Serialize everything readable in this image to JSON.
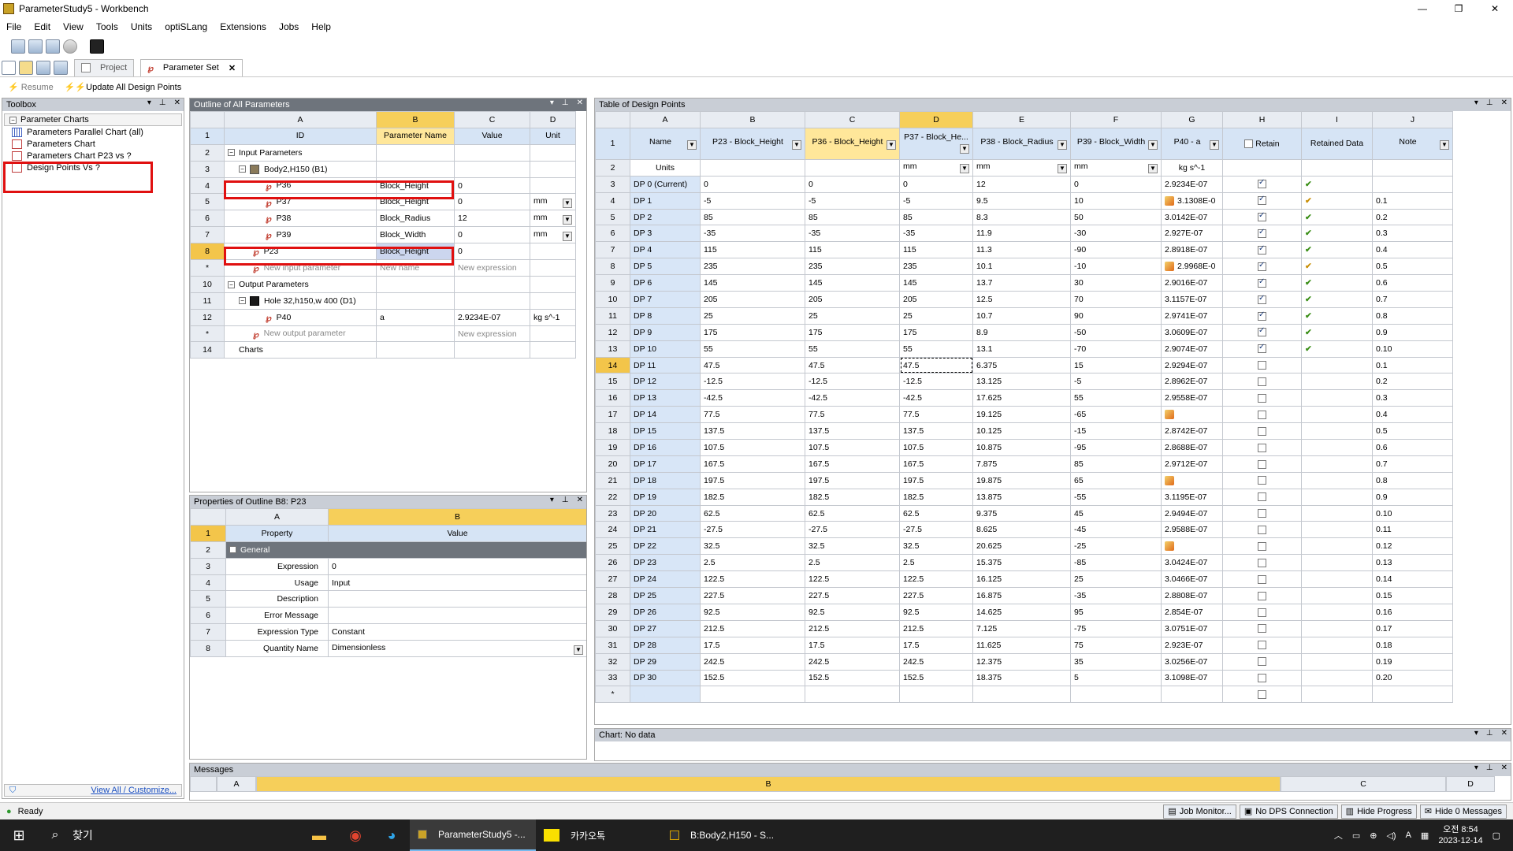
{
  "window": {
    "title": "ParameterStudy5 - Workbench"
  },
  "menu": [
    "File",
    "Edit",
    "View",
    "Tools",
    "Units",
    "optiSLang",
    "Extensions",
    "Jobs",
    "Help"
  ],
  "tabs": [
    {
      "label": "Project"
    },
    {
      "label": "Parameter Set"
    }
  ],
  "toolbar": {
    "resume": "Resume",
    "update_all": "Update All Design Points"
  },
  "toolbox": {
    "title": "Toolbox",
    "group": "Parameter Charts",
    "items": [
      "Parameters Parallel Chart (all)",
      "Parameters Chart",
      "Parameters Chart P23 vs ?",
      "Design Points Vs  ?"
    ],
    "footer": "View All / Customize..."
  },
  "outline": {
    "title": "Outline of All Parameters",
    "cols": [
      "A",
      "B",
      "C",
      "D"
    ],
    "headers": [
      "ID",
      "Parameter Name",
      "Value",
      "Unit"
    ],
    "rows": [
      {
        "n": "2",
        "id": "Input Parameters",
        "name": "",
        "value": "",
        "unit": ""
      },
      {
        "n": "3",
        "id": "Body2,H150 (B1)",
        "name": "",
        "value": "",
        "unit": ""
      },
      {
        "n": "4",
        "id": "P36",
        "name": "Block_Height",
        "value": "0",
        "unit": ""
      },
      {
        "n": "5",
        "id": "P37",
        "name": "Block_Height",
        "value": "0",
        "unit": "mm"
      },
      {
        "n": "6",
        "id": "P38",
        "name": "Block_Radius",
        "value": "12",
        "unit": "mm"
      },
      {
        "n": "7",
        "id": "P39",
        "name": "Block_Width",
        "value": "0",
        "unit": "mm"
      },
      {
        "n": "8",
        "id": "P23",
        "name": "Block_Height",
        "value": "0",
        "unit": ""
      },
      {
        "n": "*",
        "id": "New input parameter",
        "name": "New name",
        "value": "New expression",
        "unit": ""
      },
      {
        "n": "10",
        "id": "Output Parameters",
        "name": "",
        "value": "",
        "unit": ""
      },
      {
        "n": "11",
        "id": "Hole 32,h150,w 400 (D1)",
        "name": "",
        "value": "",
        "unit": ""
      },
      {
        "n": "12",
        "id": "P40",
        "name": "a",
        "value": "2.9234E-07",
        "unit": "kg s^-1"
      },
      {
        "n": "*",
        "id": "New output parameter",
        "name": "",
        "value": "New expression",
        "unit": ""
      },
      {
        "n": "14",
        "id": "Charts",
        "name": "",
        "value": "",
        "unit": ""
      }
    ]
  },
  "properties": {
    "title": "Properties of Outline B8: P23",
    "cols": [
      "A",
      "B"
    ],
    "headers": [
      "Property",
      "Value"
    ],
    "group": "General",
    "rows": [
      {
        "n": "3",
        "k": "Expression",
        "v": "0"
      },
      {
        "n": "4",
        "k": "Usage",
        "v": "Input"
      },
      {
        "n": "5",
        "k": "Description",
        "v": ""
      },
      {
        "n": "6",
        "k": "Error Message",
        "v": ""
      },
      {
        "n": "7",
        "k": "Expression Type",
        "v": "Constant"
      },
      {
        "n": "8",
        "k": "Quantity Name",
        "v": "Dimensionless"
      }
    ]
  },
  "design_points": {
    "title": "Table of Design Points",
    "cols": [
      "A",
      "B",
      "C",
      "D",
      "E",
      "F",
      "G",
      "H",
      "I",
      "J"
    ],
    "headers": [
      "Name",
      "P23 - Block_Height",
      "P36 - Block_Height",
      "P37 - Block_He...",
      "P38 - Block_Radius",
      "P39 - Block_Width",
      "P40 - a",
      "Retain",
      "Retained Data",
      "Note"
    ],
    "units": [
      "Units",
      "",
      "",
      "mm",
      "mm",
      "mm",
      "kg s^-1",
      "",
      "",
      ""
    ],
    "rows": [
      {
        "n": "3",
        "name": "DP 0 (Current)",
        "b": "0",
        "c": "0",
        "d": "0",
        "e": "12",
        "f": "0",
        "g": "2.9234E-07",
        "h": true,
        "i": "ok",
        "j": ""
      },
      {
        "n": "4",
        "name": "DP 1",
        "b": "-5",
        "c": "-5",
        "d": "-5",
        "e": "9.5",
        "f": "10",
        "g": "3.1308E-0",
        "gw": true,
        "h": true,
        "i": "or",
        "j": "0.1"
      },
      {
        "n": "5",
        "name": "DP 2",
        "b": "85",
        "c": "85",
        "d": "85",
        "e": "8.3",
        "f": "50",
        "g": "3.0142E-07",
        "h": true,
        "i": "ok",
        "j": "0.2"
      },
      {
        "n": "6",
        "name": "DP 3",
        "b": "-35",
        "c": "-35",
        "d": "-35",
        "e": "11.9",
        "f": "-30",
        "g": "2.927E-07",
        "h": true,
        "i": "ok",
        "j": "0.3"
      },
      {
        "n": "7",
        "name": "DP 4",
        "b": "115",
        "c": "115",
        "d": "115",
        "e": "11.3",
        "f": "-90",
        "g": "2.8918E-07",
        "h": true,
        "i": "ok",
        "j": "0.4"
      },
      {
        "n": "8",
        "name": "DP 5",
        "b": "235",
        "c": "235",
        "d": "235",
        "e": "10.1",
        "f": "-10",
        "g": "2.9968E-0",
        "gw": true,
        "h": true,
        "i": "or",
        "j": "0.5"
      },
      {
        "n": "9",
        "name": "DP 6",
        "b": "145",
        "c": "145",
        "d": "145",
        "e": "13.7",
        "f": "30",
        "g": "2.9016E-07",
        "h": true,
        "i": "ok",
        "j": "0.6"
      },
      {
        "n": "10",
        "name": "DP 7",
        "b": "205",
        "c": "205",
        "d": "205",
        "e": "12.5",
        "f": "70",
        "g": "3.1157E-07",
        "h": true,
        "i": "ok",
        "j": "0.7"
      },
      {
        "n": "11",
        "name": "DP 8",
        "b": "25",
        "c": "25",
        "d": "25",
        "e": "10.7",
        "f": "90",
        "g": "2.9741E-07",
        "h": true,
        "i": "ok",
        "j": "0.8"
      },
      {
        "n": "12",
        "name": "DP 9",
        "b": "175",
        "c": "175",
        "d": "175",
        "e": "8.9",
        "f": "-50",
        "g": "3.0609E-07",
        "h": true,
        "i": "ok",
        "j": "0.9"
      },
      {
        "n": "13",
        "name": "DP 10",
        "b": "55",
        "c": "55",
        "d": "55",
        "e": "13.1",
        "f": "-70",
        "g": "2.9074E-07",
        "h": true,
        "i": "ok",
        "j": "0.10"
      },
      {
        "n": "14",
        "name": "DP 11",
        "b": "47.5",
        "c": "47.5",
        "d": "47.5",
        "e": "6.375",
        "f": "15",
        "g": "2.9294E-07",
        "h": false,
        "i": "",
        "j": "0.1"
      },
      {
        "n": "15",
        "name": "DP 12",
        "b": "-12.5",
        "c": "-12.5",
        "d": "-12.5",
        "e": "13.125",
        "f": "-5",
        "g": "2.8962E-07",
        "h": false,
        "i": "",
        "j": "0.2"
      },
      {
        "n": "16",
        "name": "DP 13",
        "b": "-42.5",
        "c": "-42.5",
        "d": "-42.5",
        "e": "17.625",
        "f": "55",
        "g": "2.9558E-07",
        "h": false,
        "i": "",
        "j": "0.3"
      },
      {
        "n": "17",
        "name": "DP 14",
        "b": "77.5",
        "c": "77.5",
        "d": "77.5",
        "e": "19.125",
        "f": "-65",
        "g": "",
        "gw": true,
        "h": false,
        "i": "",
        "j": "0.4"
      },
      {
        "n": "18",
        "name": "DP 15",
        "b": "137.5",
        "c": "137.5",
        "d": "137.5",
        "e": "10.125",
        "f": "-15",
        "g": "2.8742E-07",
        "h": false,
        "i": "",
        "j": "0.5"
      },
      {
        "n": "19",
        "name": "DP 16",
        "b": "107.5",
        "c": "107.5",
        "d": "107.5",
        "e": "10.875",
        "f": "-95",
        "g": "2.8688E-07",
        "h": false,
        "i": "",
        "j": "0.6"
      },
      {
        "n": "20",
        "name": "DP 17",
        "b": "167.5",
        "c": "167.5",
        "d": "167.5",
        "e": "7.875",
        "f": "85",
        "g": "2.9712E-07",
        "h": false,
        "i": "",
        "j": "0.7"
      },
      {
        "n": "21",
        "name": "DP 18",
        "b": "197.5",
        "c": "197.5",
        "d": "197.5",
        "e": "19.875",
        "f": "65",
        "g": "",
        "gw": true,
        "h": false,
        "i": "",
        "j": "0.8"
      },
      {
        "n": "22",
        "name": "DP 19",
        "b": "182.5",
        "c": "182.5",
        "d": "182.5",
        "e": "13.875",
        "f": "-55",
        "g": "3.1195E-07",
        "h": false,
        "i": "",
        "j": "0.9"
      },
      {
        "n": "23",
        "name": "DP 20",
        "b": "62.5",
        "c": "62.5",
        "d": "62.5",
        "e": "9.375",
        "f": "45",
        "g": "2.9494E-07",
        "h": false,
        "i": "",
        "j": "0.10"
      },
      {
        "n": "24",
        "name": "DP 21",
        "b": "-27.5",
        "c": "-27.5",
        "d": "-27.5",
        "e": "8.625",
        "f": "-45",
        "g": "2.9588E-07",
        "h": false,
        "i": "",
        "j": "0.11"
      },
      {
        "n": "25",
        "name": "DP 22",
        "b": "32.5",
        "c": "32.5",
        "d": "32.5",
        "e": "20.625",
        "f": "-25",
        "g": "",
        "gw": true,
        "h": false,
        "i": "",
        "j": "0.12"
      },
      {
        "n": "26",
        "name": "DP 23",
        "b": "2.5",
        "c": "2.5",
        "d": "2.5",
        "e": "15.375",
        "f": "-85",
        "g": "3.0424E-07",
        "h": false,
        "i": "",
        "j": "0.13"
      },
      {
        "n": "27",
        "name": "DP 24",
        "b": "122.5",
        "c": "122.5",
        "d": "122.5",
        "e": "16.125",
        "f": "25",
        "g": "3.0466E-07",
        "h": false,
        "i": "",
        "j": "0.14"
      },
      {
        "n": "28",
        "name": "DP 25",
        "b": "227.5",
        "c": "227.5",
        "d": "227.5",
        "e": "16.875",
        "f": "-35",
        "g": "2.8808E-07",
        "h": false,
        "i": "",
        "j": "0.15"
      },
      {
        "n": "29",
        "name": "DP 26",
        "b": "92.5",
        "c": "92.5",
        "d": "92.5",
        "e": "14.625",
        "f": "95",
        "g": "2.854E-07",
        "h": false,
        "i": "",
        "j": "0.16"
      },
      {
        "n": "30",
        "name": "DP 27",
        "b": "212.5",
        "c": "212.5",
        "d": "212.5",
        "e": "7.125",
        "f": "-75",
        "g": "3.0751E-07",
        "h": false,
        "i": "",
        "j": "0.17"
      },
      {
        "n": "31",
        "name": "DP 28",
        "b": "17.5",
        "c": "17.5",
        "d": "17.5",
        "e": "11.625",
        "f": "75",
        "g": "2.923E-07",
        "h": false,
        "i": "",
        "j": "0.18"
      },
      {
        "n": "32",
        "name": "DP 29",
        "b": "242.5",
        "c": "242.5",
        "d": "242.5",
        "e": "12.375",
        "f": "35",
        "g": "3.0256E-07",
        "h": false,
        "i": "",
        "j": "0.19"
      },
      {
        "n": "33",
        "name": "DP 30",
        "b": "152.5",
        "c": "152.5",
        "d": "152.5",
        "e": "18.375",
        "f": "5",
        "g": "3.1098E-07",
        "h": false,
        "i": "",
        "j": "0.20"
      }
    ]
  },
  "chart": {
    "title": "Chart: No data"
  },
  "messages": {
    "title": "Messages",
    "cols": [
      "A",
      "B",
      "C",
      "D"
    ]
  },
  "status": {
    "text": "Ready",
    "job_monitor": "Job Monitor...",
    "dps": "No DPS Connection",
    "hide_progress": "Hide Progress",
    "hide_messages": "Hide 0 Messages"
  },
  "taskbar": {
    "search": "찾기",
    "apps": [
      "ParameterStudy5 -...",
      "카카오톡",
      "B:Body2,H150 - S..."
    ],
    "time": "오전 8:54",
    "date": "2023-12-14"
  },
  "colors": {
    "selected_header": "#f6cf5a",
    "row_header": "#e8ecf2",
    "column_header": "#d6e4f5",
    "highlight": "#e01010"
  }
}
